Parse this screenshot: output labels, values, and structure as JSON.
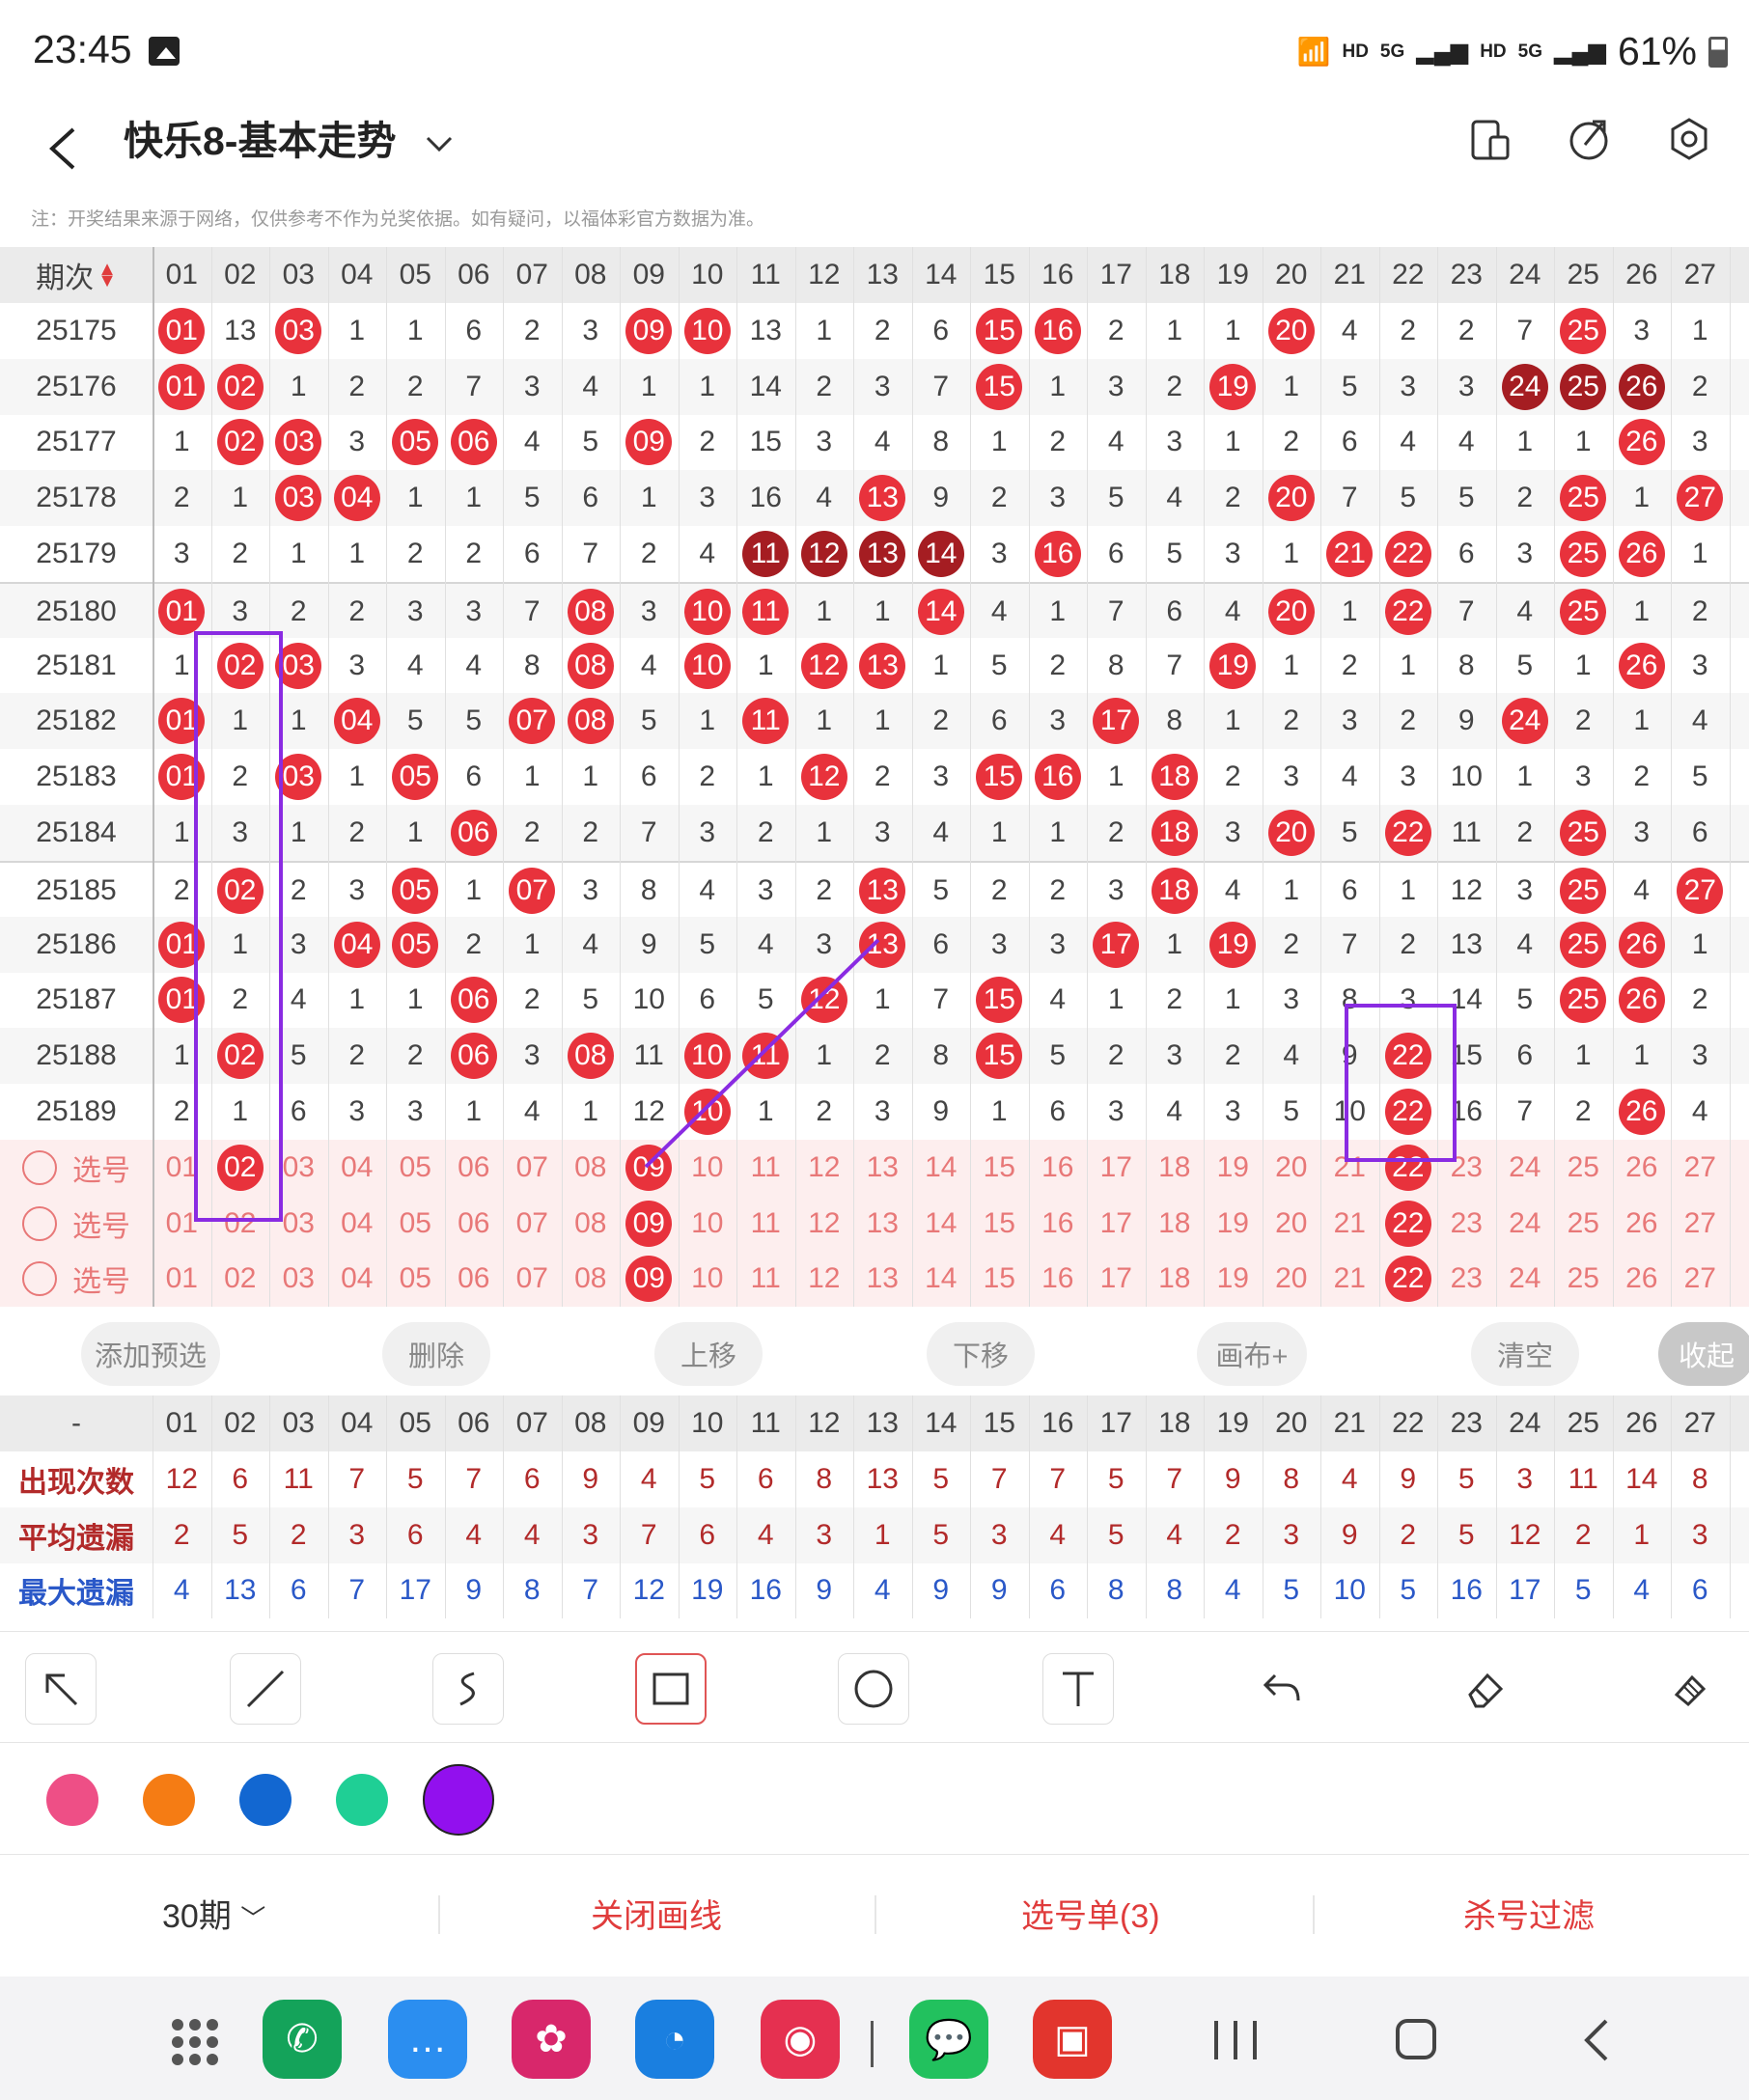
{
  "status_bar": {
    "time": "23:45",
    "net1": "HD",
    "net2": "5G",
    "net3": "HD",
    "net4": "5G",
    "battery": "61%"
  },
  "toolbar": {
    "title": "快乐8-基本走势"
  },
  "note": "注：开奖结果来源于网络，仅供参考不作为兑奖依据。如有疑问，以福体彩官方数据为准。",
  "table": {
    "period_header": "期次",
    "columns": [
      "01",
      "02",
      "03",
      "04",
      "05",
      "06",
      "07",
      "08",
      "09",
      "10",
      "11",
      "12",
      "13",
      "14",
      "15",
      "16",
      "17",
      "18",
      "19",
      "20",
      "21",
      "22",
      "23",
      "24",
      "25",
      "26",
      "27"
    ],
    "rows": [
      {
        "p": "25175",
        "v": [
          "01",
          "13",
          "03",
          "1",
          "1",
          "6",
          "2",
          "3",
          "09",
          "10",
          "13",
          "1",
          "2",
          "6",
          "15",
          "16",
          "2",
          "1",
          "1",
          "20",
          "4",
          "2",
          "2",
          "7",
          "25",
          "3",
          "1"
        ]
      },
      {
        "p": "25176",
        "v": [
          "01",
          "02",
          "1",
          "2",
          "2",
          "7",
          "3",
          "4",
          "1",
          "1",
          "14",
          "2",
          "3",
          "7",
          "15",
          "1",
          "3",
          "2",
          "19",
          "1",
          "5",
          "3",
          "3",
          "24",
          "25",
          "26",
          "2"
        ]
      },
      {
        "p": "25177",
        "v": [
          "1",
          "02",
          "03",
          "3",
          "05",
          "06",
          "4",
          "5",
          "09",
          "2",
          "15",
          "3",
          "4",
          "8",
          "1",
          "2",
          "4",
          "3",
          "1",
          "2",
          "6",
          "4",
          "4",
          "1",
          "1",
          "26",
          "3"
        ]
      },
      {
        "p": "25178",
        "v": [
          "2",
          "1",
          "03",
          "04",
          "1",
          "1",
          "5",
          "6",
          "1",
          "3",
          "16",
          "4",
          "13",
          "9",
          "2",
          "3",
          "5",
          "4",
          "2",
          "20",
          "7",
          "5",
          "5",
          "2",
          "25",
          "1",
          "27"
        ]
      },
      {
        "p": "25179",
        "v": [
          "3",
          "2",
          "1",
          "1",
          "2",
          "2",
          "6",
          "7",
          "2",
          "4",
          "11",
          "12",
          "13",
          "14",
          "3",
          "16",
          "6",
          "5",
          "3",
          "1",
          "21",
          "22",
          "6",
          "3",
          "25",
          "26",
          "1"
        ]
      },
      {
        "p": "25180",
        "v": [
          "01",
          "3",
          "2",
          "2",
          "3",
          "3",
          "7",
          "08",
          "3",
          "10",
          "11",
          "1",
          "1",
          "14",
          "4",
          "1",
          "7",
          "6",
          "4",
          "20",
          "1",
          "22",
          "7",
          "4",
          "25",
          "1",
          "2"
        ]
      },
      {
        "p": "25181",
        "v": [
          "1",
          "02",
          "03",
          "3",
          "4",
          "4",
          "8",
          "08",
          "4",
          "10",
          "1",
          "12",
          "13",
          "1",
          "5",
          "2",
          "8",
          "7",
          "19",
          "1",
          "2",
          "1",
          "8",
          "5",
          "1",
          "26",
          "3"
        ]
      },
      {
        "p": "25182",
        "v": [
          "01",
          "1",
          "1",
          "04",
          "5",
          "5",
          "07",
          "08",
          "5",
          "1",
          "11",
          "1",
          "1",
          "2",
          "6",
          "3",
          "17",
          "8",
          "1",
          "2",
          "3",
          "2",
          "9",
          "24",
          "2",
          "1",
          "4"
        ]
      },
      {
        "p": "25183",
        "v": [
          "01",
          "2",
          "03",
          "1",
          "05",
          "6",
          "1",
          "1",
          "6",
          "2",
          "1",
          "12",
          "2",
          "3",
          "15",
          "16",
          "1",
          "18",
          "2",
          "3",
          "4",
          "3",
          "10",
          "1",
          "3",
          "2",
          "5"
        ]
      },
      {
        "p": "25184",
        "v": [
          "1",
          "3",
          "1",
          "2",
          "1",
          "06",
          "2",
          "2",
          "7",
          "3",
          "2",
          "1",
          "3",
          "4",
          "1",
          "1",
          "2",
          "18",
          "3",
          "20",
          "5",
          "22",
          "11",
          "2",
          "25",
          "3",
          "6"
        ]
      },
      {
        "p": "25185",
        "v": [
          "2",
          "02",
          "2",
          "3",
          "05",
          "1",
          "07",
          "3",
          "8",
          "4",
          "3",
          "2",
          "13",
          "5",
          "2",
          "2",
          "3",
          "18",
          "4",
          "1",
          "6",
          "1",
          "12",
          "3",
          "25",
          "4",
          "27"
        ]
      },
      {
        "p": "25186",
        "v": [
          "01",
          "1",
          "3",
          "04",
          "05",
          "2",
          "1",
          "4",
          "9",
          "5",
          "4",
          "3",
          "13",
          "6",
          "3",
          "3",
          "17",
          "1",
          "19",
          "2",
          "7",
          "2",
          "13",
          "4",
          "25",
          "26",
          "1"
        ]
      },
      {
        "p": "25187",
        "v": [
          "01",
          "2",
          "4",
          "1",
          "1",
          "06",
          "2",
          "5",
          "10",
          "6",
          "5",
          "12",
          "1",
          "7",
          "15",
          "4",
          "1",
          "2",
          "1",
          "3",
          "8",
          "3",
          "14",
          "5",
          "25",
          "26",
          "2"
        ]
      },
      {
        "p": "25188",
        "v": [
          "1",
          "02",
          "5",
          "2",
          "2",
          "06",
          "3",
          "08",
          "11",
          "10",
          "11",
          "1",
          "2",
          "8",
          "15",
          "5",
          "2",
          "3",
          "2",
          "4",
          "9",
          "22",
          "15",
          "6",
          "1",
          "1",
          "3"
        ]
      },
      {
        "p": "25189",
        "v": [
          "2",
          "1",
          "6",
          "3",
          "3",
          "1",
          "4",
          "1",
          "12",
          "10",
          "1",
          "2",
          "3",
          "9",
          "1",
          "6",
          "3",
          "4",
          "3",
          "5",
          "10",
          "22",
          "16",
          "7",
          "2",
          "26",
          "4"
        ]
      }
    ],
    "pick_label": "选号",
    "pick_rows": [
      {
        "v": [
          "01",
          "02",
          "03",
          "04",
          "05",
          "06",
          "07",
          "08",
          "09",
          "10",
          "11",
          "12",
          "13",
          "14",
          "15",
          "16",
          "17",
          "18",
          "19",
          "20",
          "21",
          "22",
          "23",
          "24",
          "25",
          "26",
          "27"
        ],
        "sel": [
          "02",
          "09",
          "22"
        ]
      },
      {
        "v": [
          "01",
          "02",
          "03",
          "04",
          "05",
          "06",
          "07",
          "08",
          "09",
          "10",
          "11",
          "12",
          "13",
          "14",
          "15",
          "16",
          "17",
          "18",
          "19",
          "20",
          "21",
          "22",
          "23",
          "24",
          "25",
          "26",
          "27"
        ],
        "sel": [
          "09",
          "22"
        ]
      },
      {
        "v": [
          "01",
          "02",
          "03",
          "04",
          "05",
          "06",
          "07",
          "08",
          "09",
          "10",
          "11",
          "12",
          "13",
          "14",
          "15",
          "16",
          "17",
          "18",
          "19",
          "20",
          "21",
          "22",
          "23",
          "24",
          "25",
          "26",
          "27"
        ],
        "sel": [
          "09",
          "22"
        ]
      }
    ],
    "dark_cells": [
      [
        "25176",
        "24"
      ],
      [
        "25176",
        "25"
      ],
      [
        "25176",
        "26"
      ],
      [
        "25179",
        "11"
      ],
      [
        "25179",
        "12"
      ],
      [
        "25179",
        "13"
      ],
      [
        "25179",
        "14"
      ]
    ]
  },
  "actions": {
    "add": "添加预选",
    "delete": "删除",
    "up": "上移",
    "down": "下移",
    "canvas": "画布+",
    "clear": "清空",
    "collapse": "收起"
  },
  "stats": {
    "dash": "-",
    "rows": [
      {
        "label": "出现次数",
        "color": "#b22a2a",
        "v": [
          "12",
          "6",
          "11",
          "7",
          "5",
          "7",
          "6",
          "9",
          "4",
          "5",
          "6",
          "8",
          "13",
          "5",
          "7",
          "7",
          "5",
          "7",
          "9",
          "8",
          "4",
          "9",
          "5",
          "3",
          "11",
          "14",
          "8"
        ]
      },
      {
        "label": "平均遗漏",
        "color": "#b22a2a",
        "v": [
          "2",
          "5",
          "2",
          "3",
          "6",
          "4",
          "4",
          "3",
          "7",
          "6",
          "4",
          "3",
          "1",
          "5",
          "3",
          "4",
          "5",
          "4",
          "2",
          "3",
          "9",
          "2",
          "5",
          "12",
          "2",
          "1",
          "3"
        ]
      },
      {
        "label": "最大遗漏",
        "color": "#2a58c8",
        "v": [
          "4",
          "13",
          "6",
          "7",
          "17",
          "9",
          "8",
          "7",
          "12",
          "19",
          "16",
          "9",
          "4",
          "9",
          "9",
          "6",
          "8",
          "8",
          "4",
          "5",
          "10",
          "5",
          "16",
          "17",
          "5",
          "4",
          "6"
        ]
      }
    ]
  },
  "palette": [
    "#ee4f86",
    "#f57c14",
    "#1267d1",
    "#1fcf95",
    "#9210ee"
  ],
  "bottom": {
    "period": "30期",
    "close_line": "关闭画线",
    "pick_list": "选号单(3)",
    "kill_filter": "杀号过滤"
  }
}
